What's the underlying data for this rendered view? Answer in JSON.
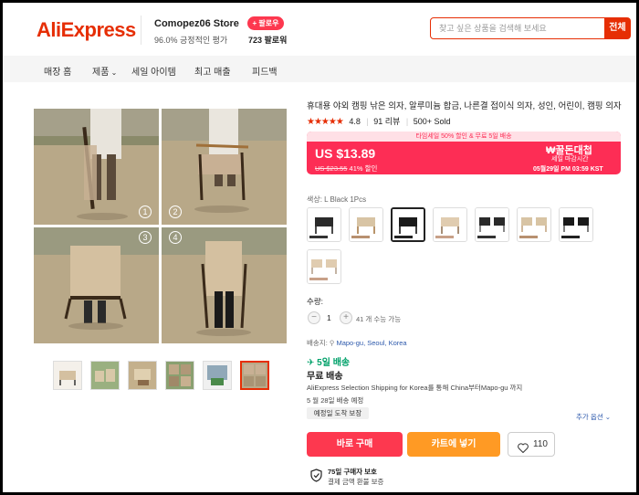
{
  "header": {
    "logo": "AliExpress",
    "store_name": "Comopez06 Store",
    "store_rating": "96.0% 긍정적인 평가",
    "follow_label": "+ 팔로우",
    "followers": "723 팔로워",
    "search_placeholder": "찾고 싶은 상품을 검색해 보세요",
    "search_button": "전체"
  },
  "nav": {
    "items": [
      "매장 홈",
      "제품",
      "세일 아이템",
      "최고 매출",
      "피드백"
    ]
  },
  "gallery": {
    "step_numbers": [
      "1",
      "2",
      "3",
      "4"
    ],
    "thumbnail_count": 6,
    "selected_thumbnail": 6
  },
  "product": {
    "title": "휴대용 야외 캠핑 낚은 의자, 알루미늄 합금, 나른결 접이식 의자, 성인, 어린이, 캠핑 의자",
    "stars": "★★★★★",
    "rating": "4.8",
    "reviews": "91 리뷰",
    "sold": "500+ Sold"
  },
  "price": {
    "band_text": "타임세일 50% 할인 & 무료 5일 배송",
    "current": "US $13.89",
    "original": "US $23.55",
    "discount": "41% 할인",
    "promo_title": "₩꿀돈대첩",
    "promo_sub": "세일 마감시간",
    "deadline": "05월29일 PM 03:59 KST",
    "colors": {
      "primary": "#fd2d55",
      "band": "#ffe0e6"
    }
  },
  "options": {
    "color_label": "색상: L Black 1Pcs",
    "selected_index": 2,
    "swatch_count": 8
  },
  "quantity": {
    "label": "수량:",
    "minus": "−",
    "value": "1",
    "plus": "+",
    "available": "41 개 수능 가능"
  },
  "shipping": {
    "ship_to_label": "배송지:",
    "location": "Mapo-gu, Seoul, Korea",
    "days": "5일 배송",
    "free": "무료 배송",
    "description": "AliExpress Selection Shipping for Korea를 통해 China부터Mapo-gu 까지",
    "date": "5 월 28일 배송 예정",
    "eta_badge": "예정일 도착 보장",
    "more_options": "추가 옵션"
  },
  "actions": {
    "buy": "바로 구매",
    "cart": "카트에 넣기",
    "wishlist_count": "110"
  },
  "protection": {
    "line1": "75일 구매자 보호",
    "line2": "결제 금액 환불 보증"
  }
}
